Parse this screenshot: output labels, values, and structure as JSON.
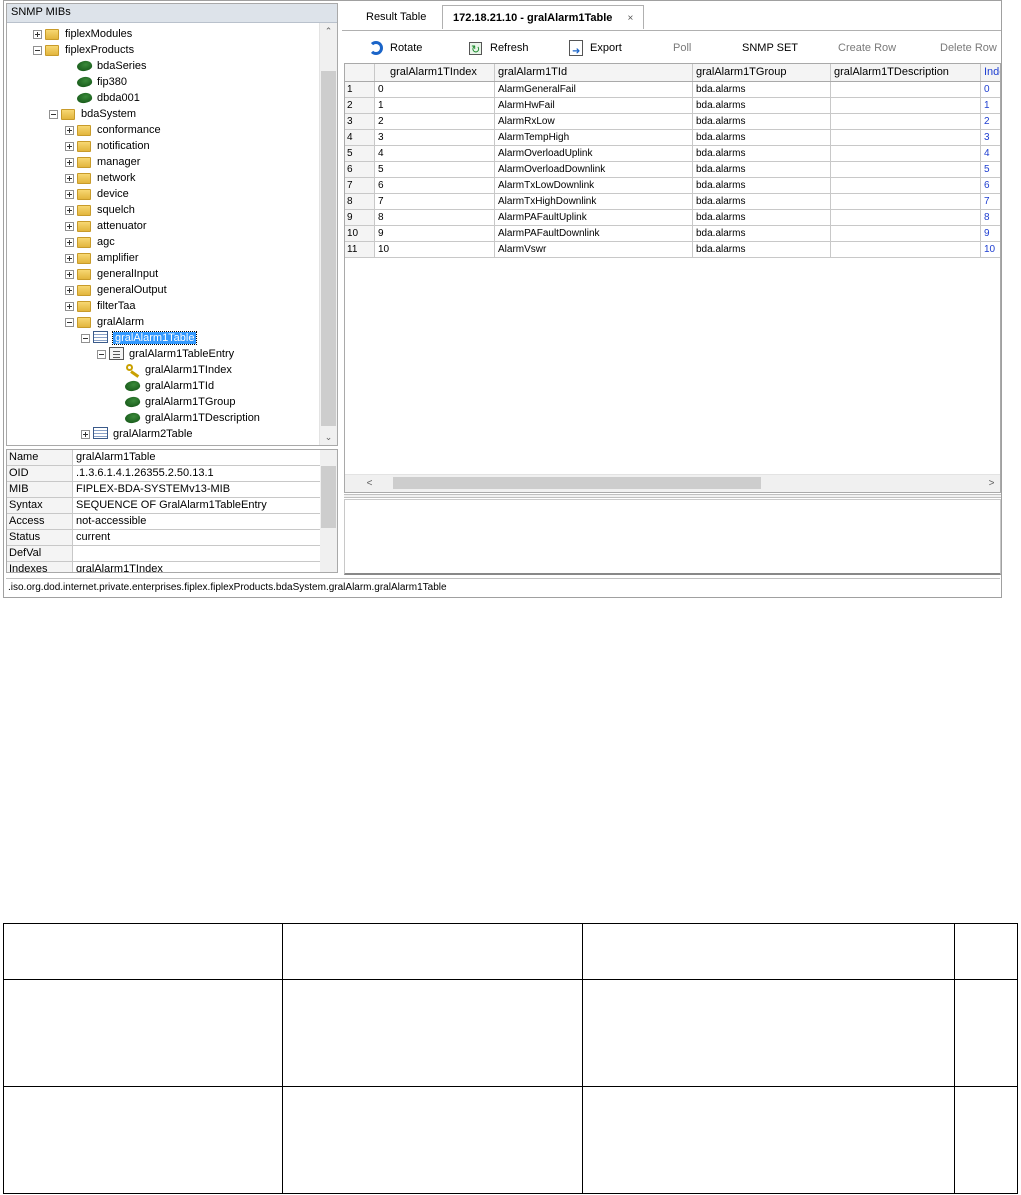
{
  "tree": {
    "header": "SNMP MIBs",
    "nodes": [
      {
        "label": "fiplexModules",
        "icon": "folder-icon"
      },
      {
        "label": "fiplexProducts",
        "icon": "folder-icon"
      },
      {
        "label": "bdaSeries",
        "icon": "leaf-icon"
      },
      {
        "label": "fip380",
        "icon": "leaf-icon"
      },
      {
        "label": "dbda001",
        "icon": "leaf-icon"
      },
      {
        "label": "bdaSystem",
        "icon": "folder-icon"
      },
      {
        "label": "conformance",
        "icon": "folder-icon"
      },
      {
        "label": "notification",
        "icon": "folder-icon"
      },
      {
        "label": "manager",
        "icon": "folder-icon"
      },
      {
        "label": "network",
        "icon": "folder-icon"
      },
      {
        "label": "device",
        "icon": "folder-icon"
      },
      {
        "label": "squelch",
        "icon": "folder-icon"
      },
      {
        "label": "attenuator",
        "icon": "folder-icon"
      },
      {
        "label": "agc",
        "icon": "folder-icon"
      },
      {
        "label": "amplifier",
        "icon": "folder-icon"
      },
      {
        "label": "generalInput",
        "icon": "folder-icon"
      },
      {
        "label": "generalOutput",
        "icon": "folder-icon"
      },
      {
        "label": "filterTaa",
        "icon": "folder-icon"
      },
      {
        "label": "gralAlarm",
        "icon": "folder-icon"
      },
      {
        "label": "gralAlarm1Table",
        "icon": "table-icon",
        "selected": true
      },
      {
        "label": "gralAlarm1TableEntry",
        "icon": "entry-icon"
      },
      {
        "label": "gralAlarm1TIndex",
        "icon": "key-icon"
      },
      {
        "label": "gralAlarm1TId",
        "icon": "leaf-icon"
      },
      {
        "label": "gralAlarm1TGroup",
        "icon": "leaf-icon"
      },
      {
        "label": "gralAlarm1TDescription",
        "icon": "leaf-icon"
      },
      {
        "label": "gralAlarm2Table",
        "icon": "table-icon"
      }
    ]
  },
  "properties": [
    {
      "name": "Name",
      "value": "gralAlarm1Table"
    },
    {
      "name": "OID",
      "value": ".1.3.6.1.4.1.26355.2.50.13.1"
    },
    {
      "name": "MIB",
      "value": "FIPLEX-BDA-SYSTEMv13-MIB"
    },
    {
      "name": "Syntax",
      "value": "SEQUENCE OF GralAlarm1TableEntry"
    },
    {
      "name": "Access",
      "value": "not-accessible"
    },
    {
      "name": "Status",
      "value": "current"
    },
    {
      "name": "DefVal",
      "value": ""
    },
    {
      "name": "Indexes",
      "value": "gralAlarm1TIndex"
    }
  ],
  "status_path": ".iso.org.dod.internet.private.enterprises.fiplex.fiplexProducts.bdaSystem.gralAlarm.gralAlarm1Table",
  "tabs": {
    "result_table": "Result Table",
    "active": "172.18.21.10 - gralAlarm1Table",
    "close": "×"
  },
  "toolbar": {
    "rotate": "Rotate",
    "refresh": "Refresh",
    "export": "Export",
    "poll": "Poll",
    "snmp_set": "SNMP SET",
    "create_row": "Create Row",
    "delete_row": "Delete Row"
  },
  "grid": {
    "columns": [
      "",
      "gralAlarm1TIndex",
      "gralAlarm1TId",
      "gralAlarm1TGroup",
      "gralAlarm1TDescription",
      "Inde"
    ],
    "rows": [
      [
        "1",
        "0",
        "AlarmGeneralFail",
        "bda.alarms",
        "",
        "0"
      ],
      [
        "2",
        "1",
        "AlarmHwFail",
        "bda.alarms",
        "",
        "1"
      ],
      [
        "3",
        "2",
        "AlarmRxLow",
        "bda.alarms",
        "",
        "2"
      ],
      [
        "4",
        "3",
        "AlarmTempHigh",
        "bda.alarms",
        "",
        "3"
      ],
      [
        "5",
        "4",
        "AlarmOverloadUplink",
        "bda.alarms",
        "",
        "4"
      ],
      [
        "6",
        "5",
        "AlarmOverloadDownlink",
        "bda.alarms",
        "",
        "5"
      ],
      [
        "7",
        "6",
        "AlarmTxLowDownlink",
        "bda.alarms",
        "",
        "6"
      ],
      [
        "8",
        "7",
        "AlarmTxHighDownlink",
        "bda.alarms",
        "",
        "7"
      ],
      [
        "9",
        "8",
        "AlarmPAFaultUplink",
        "bda.alarms",
        "",
        "8"
      ],
      [
        "10",
        "9",
        "AlarmPAFaultDownlink",
        "bda.alarms",
        "",
        "9"
      ],
      [
        "11",
        "10",
        "AlarmVswr",
        "bda.alarms",
        "",
        "10"
      ]
    ]
  },
  "colors": {
    "selection": "#3399ff",
    "link_text": "#1f3fd1",
    "header_bg": "#dde3ea"
  }
}
